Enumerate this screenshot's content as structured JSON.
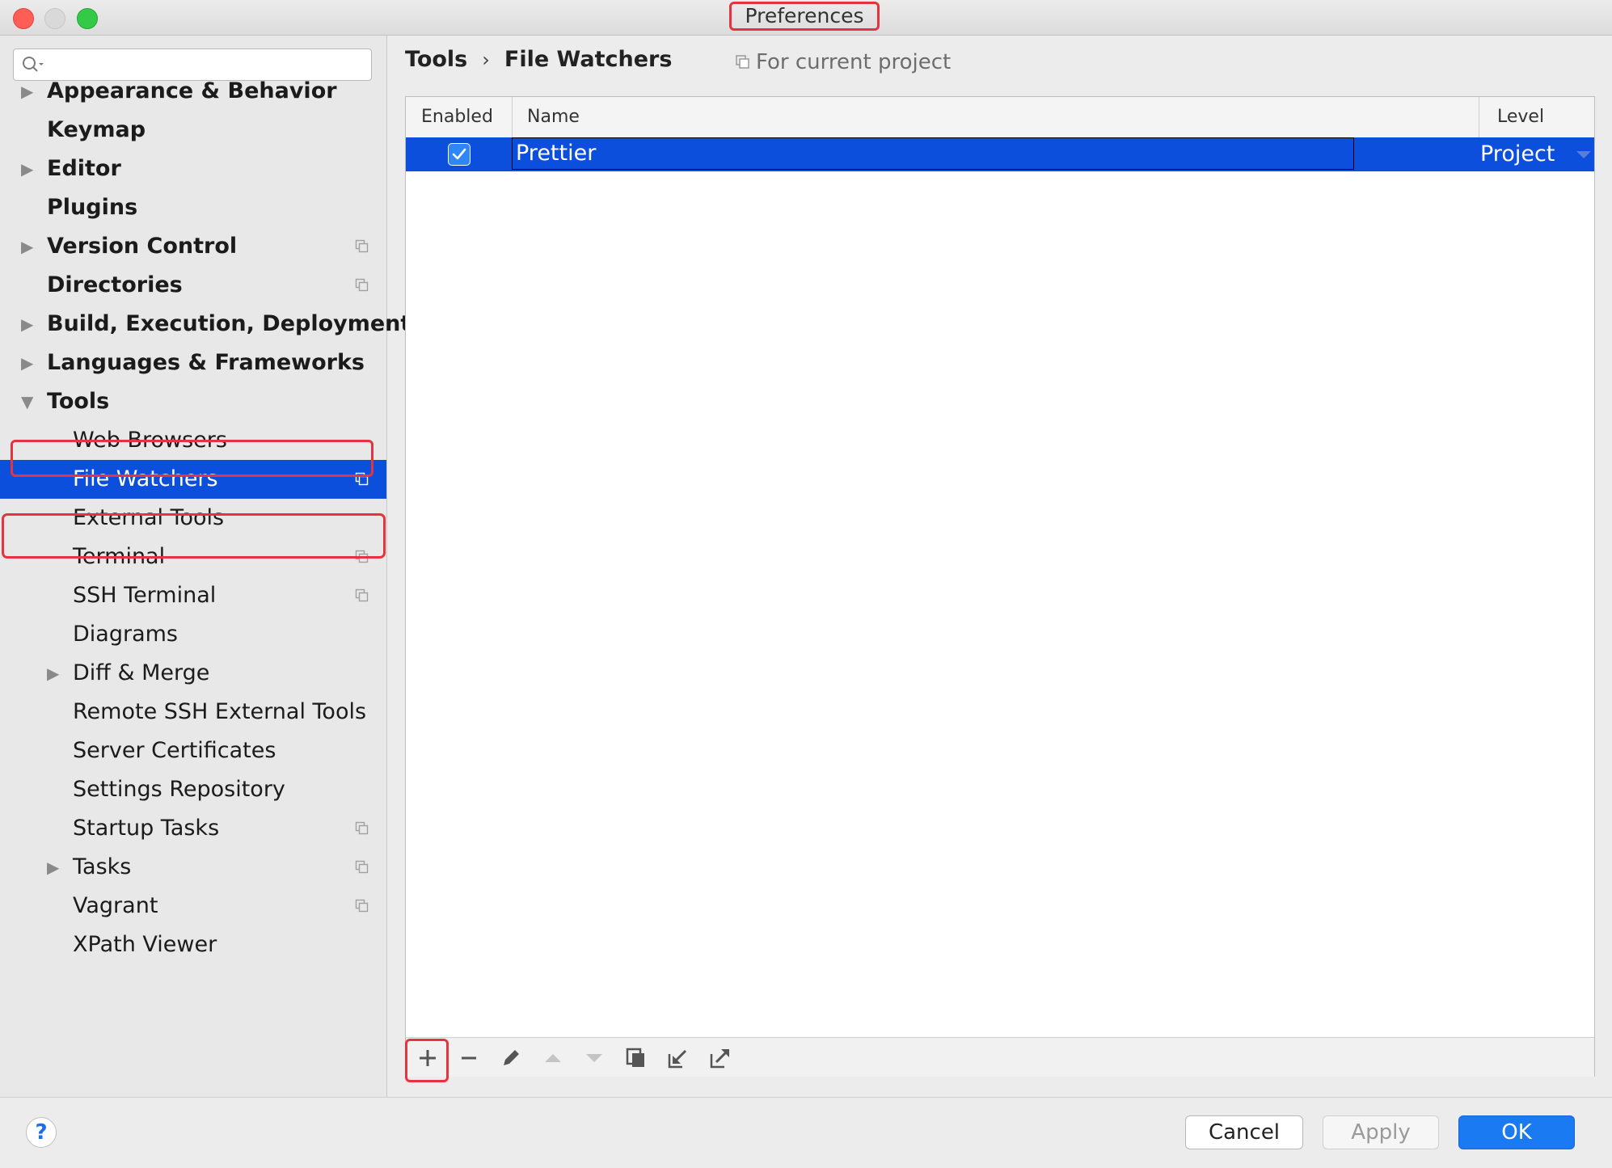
{
  "window": {
    "title": "Preferences"
  },
  "search": {
    "placeholder": ""
  },
  "sidebar": {
    "items": [
      {
        "label": "Appearance & Behavior",
        "level": "top",
        "expandable": true,
        "expanded": false,
        "project_icon": false
      },
      {
        "label": "Keymap",
        "level": "top",
        "expandable": false,
        "project_icon": false
      },
      {
        "label": "Editor",
        "level": "top",
        "expandable": true,
        "expanded": false,
        "project_icon": false
      },
      {
        "label": "Plugins",
        "level": "top",
        "expandable": false,
        "project_icon": false
      },
      {
        "label": "Version Control",
        "level": "top",
        "expandable": true,
        "expanded": false,
        "project_icon": true
      },
      {
        "label": "Directories",
        "level": "top",
        "expandable": false,
        "project_icon": true
      },
      {
        "label": "Build, Execution, Deployment",
        "level": "top",
        "expandable": true,
        "expanded": false,
        "project_icon": false
      },
      {
        "label": "Languages & Frameworks",
        "level": "top",
        "expandable": true,
        "expanded": false,
        "project_icon": false
      },
      {
        "label": "Tools",
        "level": "top",
        "expandable": true,
        "expanded": true,
        "project_icon": false
      },
      {
        "label": "Web Browsers",
        "level": "child",
        "expandable": false,
        "project_icon": false
      },
      {
        "label": "File Watchers",
        "level": "child",
        "expandable": false,
        "project_icon": true,
        "selected": true
      },
      {
        "label": "External Tools",
        "level": "child",
        "expandable": false,
        "project_icon": false
      },
      {
        "label": "Terminal",
        "level": "child",
        "expandable": false,
        "project_icon": true
      },
      {
        "label": "SSH Terminal",
        "level": "child",
        "expandable": false,
        "project_icon": true
      },
      {
        "label": "Diagrams",
        "level": "child",
        "expandable": false,
        "project_icon": false
      },
      {
        "label": "Diff & Merge",
        "level": "child",
        "expandable": true,
        "expanded": false,
        "project_icon": false
      },
      {
        "label": "Remote SSH External Tools",
        "level": "child",
        "expandable": false,
        "project_icon": false
      },
      {
        "label": "Server Certificates",
        "level": "child",
        "expandable": false,
        "project_icon": false
      },
      {
        "label": "Settings Repository",
        "level": "child",
        "expandable": false,
        "project_icon": false
      },
      {
        "label": "Startup Tasks",
        "level": "child",
        "expandable": false,
        "project_icon": true
      },
      {
        "label": "Tasks",
        "level": "child",
        "expandable": true,
        "expanded": false,
        "project_icon": true
      },
      {
        "label": "Vagrant",
        "level": "child",
        "expandable": false,
        "project_icon": true
      },
      {
        "label": "XPath Viewer",
        "level": "child",
        "expandable": false,
        "project_icon": false
      }
    ]
  },
  "breadcrumb": {
    "parent": "Tools",
    "separator": "›",
    "current": "File Watchers"
  },
  "scope": {
    "label": "For current project"
  },
  "table": {
    "columns": [
      "Enabled",
      "Name",
      "Level"
    ],
    "rows": [
      {
        "enabled": true,
        "name": "Prettier",
        "level": "Project"
      }
    ]
  },
  "toolbar": {
    "buttons": [
      "add-icon",
      "remove-icon",
      "edit-icon",
      "move-up-icon",
      "move-down-icon",
      "copy-icon",
      "import-icon",
      "export-icon"
    ]
  },
  "footer": {
    "help": "?",
    "cancel": "Cancel",
    "apply": "Apply",
    "ok": "OK"
  },
  "colors": {
    "selection": "#0b4fdc",
    "accent": "#1a7af2",
    "highlight": "#e5343f"
  }
}
